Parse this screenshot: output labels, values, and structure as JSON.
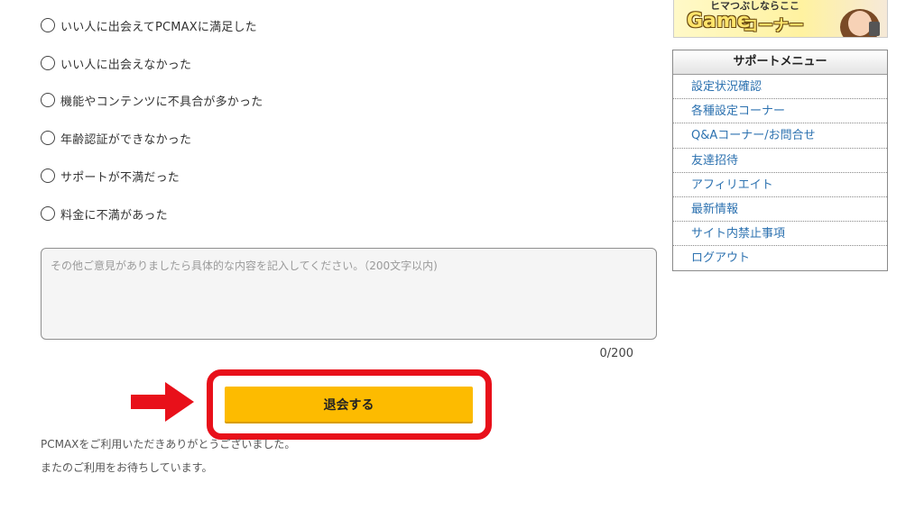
{
  "survey": {
    "options": [
      "いい人に出会えてPCMAXに満足した",
      "いい人に出会えなかった",
      "機能やコンテンツに不具合が多かった",
      "年齢認証ができなかった",
      "サポートが不満だった",
      "料金に不満があった"
    ],
    "comment_placeholder": "その他ご意見がありましたら具体的な内容を記入してください。（200文字以内)",
    "char_count": "0/200",
    "submit_label": "退会する"
  },
  "footer": {
    "line1": "PCMAXをご利用いただきありがとうございました。",
    "line2": "またのご利用をお待ちしています。"
  },
  "banner": {
    "tagline": "ヒマつぶしならここ",
    "logo": "Game",
    "subtitle": "コーナー"
  },
  "support_menu": {
    "title": "サポートメニュー",
    "items": [
      "設定状況確認",
      "各種設定コーナー",
      "Q&Aコーナー/お問合せ",
      "友達招待",
      "アフィリエイト",
      "最新情報",
      "サイト内禁止事項",
      "ログアウト"
    ]
  },
  "colors": {
    "button": "#fdbb00",
    "highlight": "#e8101a",
    "link": "#2d72b0"
  }
}
